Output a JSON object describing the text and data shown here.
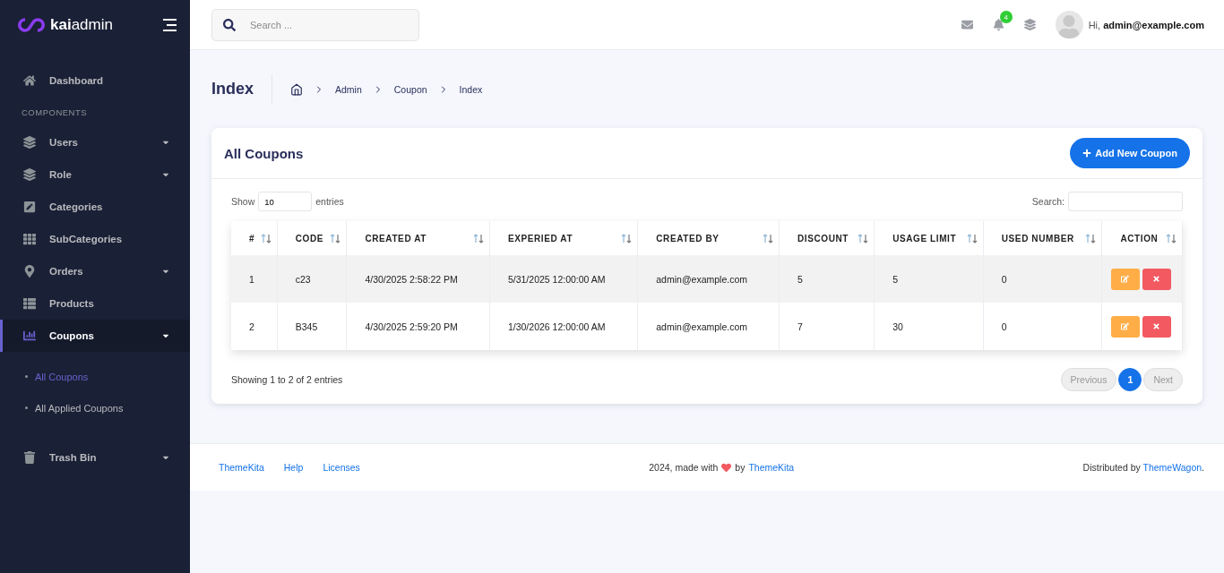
{
  "brand": {
    "prefix": "kai",
    "suffix": "admin"
  },
  "sidebar": {
    "items": [
      {
        "label": "Dashboard",
        "has_caret": false,
        "selected": false
      },
      {
        "kind": "section",
        "label": "COMPONENTS"
      },
      {
        "label": "Users",
        "has_caret": true,
        "selected": false
      },
      {
        "label": "Role",
        "has_caret": true,
        "selected": false
      },
      {
        "label": "Categories",
        "has_caret": false,
        "selected": false
      },
      {
        "label": "SubCategories",
        "has_caret": false,
        "selected": false
      },
      {
        "label": "Orders",
        "has_caret": true,
        "selected": false
      },
      {
        "label": "Products",
        "has_caret": false,
        "selected": false
      },
      {
        "label": "Coupons",
        "has_caret": true,
        "selected": true,
        "expanded": true,
        "children": [
          {
            "label": "All Coupons",
            "selected": true
          },
          {
            "label": "All Applied Coupons",
            "selected": false
          }
        ]
      },
      {
        "label": "Trash Bin",
        "has_caret": true,
        "selected": false
      }
    ]
  },
  "topbar": {
    "search": {
      "placeholder": "Search ..."
    },
    "notification_count": "4",
    "greeting": "Hi, **admin@example.com**"
  },
  "page": {
    "title": "Index",
    "breadcrumb": [
      "Admin",
      "Coupon",
      "Index"
    ]
  },
  "card": {
    "title": "All Coupons",
    "add_button": "Add New Coupon",
    "length": {
      "before": "Show",
      "value": "10",
      "after": "entries"
    },
    "search_label": "Search:",
    "table": {
      "columns": [
        "#",
        "CODE",
        "CREATED AT",
        "EXPERIED AT",
        "CREATED BY",
        "DISCOUNT",
        "USAGE LIMIT",
        "USED NUMBER",
        "ACTION"
      ],
      "rows": [
        [
          "1",
          "c23",
          "4/30/2025 2:58:22 PM",
          "5/31/2025 12:00:00 AM",
          "admin@example.com",
          "5",
          "5",
          "0"
        ],
        [
          "2",
          "B345",
          "4/30/2025 2:59:20 PM",
          "1/30/2026 12:00:00 AM",
          "admin@example.com",
          "7",
          "30",
          "0"
        ]
      ]
    },
    "info": "Showing 1 to 2 of 2 entries",
    "pagination": [
      {
        "label": "Previous",
        "disabled": true,
        "selected": false
      },
      {
        "label": "1",
        "disabled": false,
        "selected": true
      },
      {
        "label": "Next",
        "disabled": true,
        "selected": false
      }
    ]
  },
  "footer": {
    "links": [
      "ThemeKita",
      "Help",
      "Licenses"
    ],
    "made_with": "2024, made with",
    "by": "by",
    "made_link": "ThemeKita",
    "distributed": "Distributed by",
    "distributed_link": "ThemeWagon",
    "period": "."
  }
}
